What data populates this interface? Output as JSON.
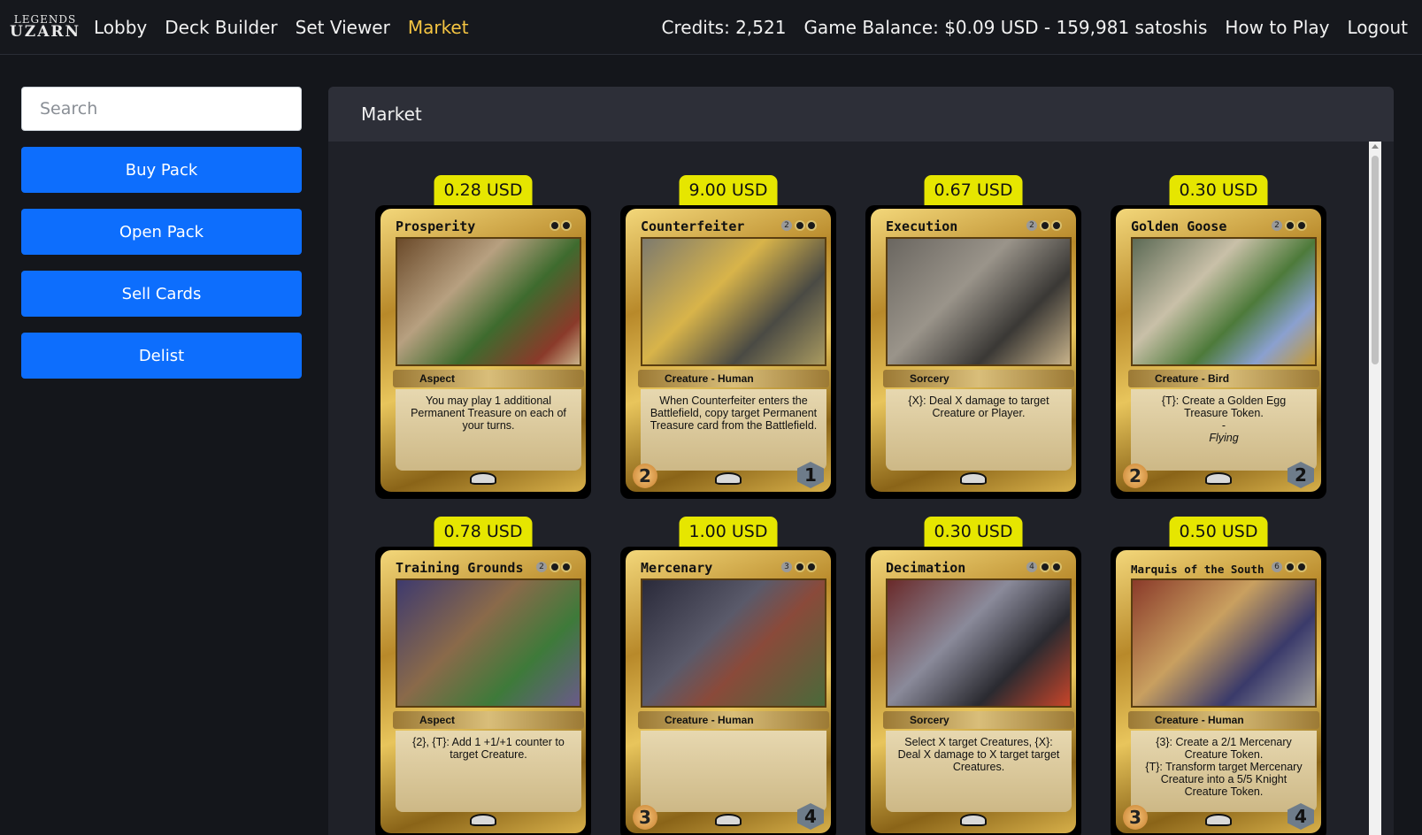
{
  "nav": {
    "logo_top": "LEGENDS",
    "logo_bottom": "UZARN",
    "links": [
      "Lobby",
      "Deck Builder",
      "Set Viewer",
      "Market"
    ],
    "credits": "Credits: 2,521",
    "balance": "Game Balance: $0.09 USD - 159,981 satoshis",
    "how_to_play": "How to Play",
    "logout": "Logout",
    "active_color": "#f5c542"
  },
  "sidebar": {
    "search_placeholder": "Search",
    "buttons": [
      "Buy Pack",
      "Open Pack",
      "Sell Cards",
      "Delist"
    ],
    "button_color": "#0d6efd"
  },
  "market": {
    "title": "Market",
    "price_color": "#e6e600",
    "cards": [
      {
        "price": "0.28 USD",
        "name": "Prosperity",
        "cost": "",
        "type": "Aspect",
        "text": [
          "You may play 1 additional Permanent Treasure on each of your turns."
        ],
        "flavor": "",
        "attack": "",
        "defense": ""
      },
      {
        "price": "9.00 USD",
        "name": "Counterfeiter",
        "cost": "2",
        "type": "Creature - Human",
        "text": [
          "When Counterfeiter enters the Battlefield, copy target Permanent Treasure card from the Battlefield."
        ],
        "flavor": "",
        "attack": "2",
        "defense": "1"
      },
      {
        "price": "0.67 USD",
        "name": "Execution",
        "cost": "2",
        "type": "Sorcery",
        "text": [
          "{X}: Deal X damage to target Creature or Player."
        ],
        "flavor": "",
        "attack": "",
        "defense": ""
      },
      {
        "price": "0.30 USD",
        "name": "Golden Goose",
        "cost": "2",
        "type": "Creature - Bird",
        "text": [
          "{T}: Create a Golden Egg Treasure Token.",
          "-"
        ],
        "flavor": "Flying",
        "attack": "2",
        "defense": "2"
      },
      {
        "price": "0.78 USD",
        "name": "Training Grounds",
        "cost": "2",
        "type": "Aspect",
        "text": [
          "{2}, {T}: Add 1 +1/+1 counter to target Creature."
        ],
        "flavor": "",
        "attack": "",
        "defense": ""
      },
      {
        "price": "1.00 USD",
        "name": "Mercenary",
        "cost": "3",
        "type": "Creature - Human",
        "text": [
          ""
        ],
        "flavor": "",
        "attack": "3",
        "defense": "4"
      },
      {
        "price": "0.30 USD",
        "name": "Decimation",
        "cost": "4",
        "type": "Sorcery",
        "text": [
          "Select X target Creatures, {X}: Deal X damage to X target target Creatures."
        ],
        "flavor": "",
        "attack": "",
        "defense": ""
      },
      {
        "price": "0.50 USD",
        "name": "Marquis of the South",
        "cost": "6",
        "type": "Creature - Human",
        "text": [
          "{3}: Create a 2/1 Mercenary Creature Token.",
          "{T}: Transform target Mercenary Creature into a 5/5 Knight Creature Token."
        ],
        "flavor": "",
        "attack": "3",
        "defense": "4"
      }
    ]
  }
}
